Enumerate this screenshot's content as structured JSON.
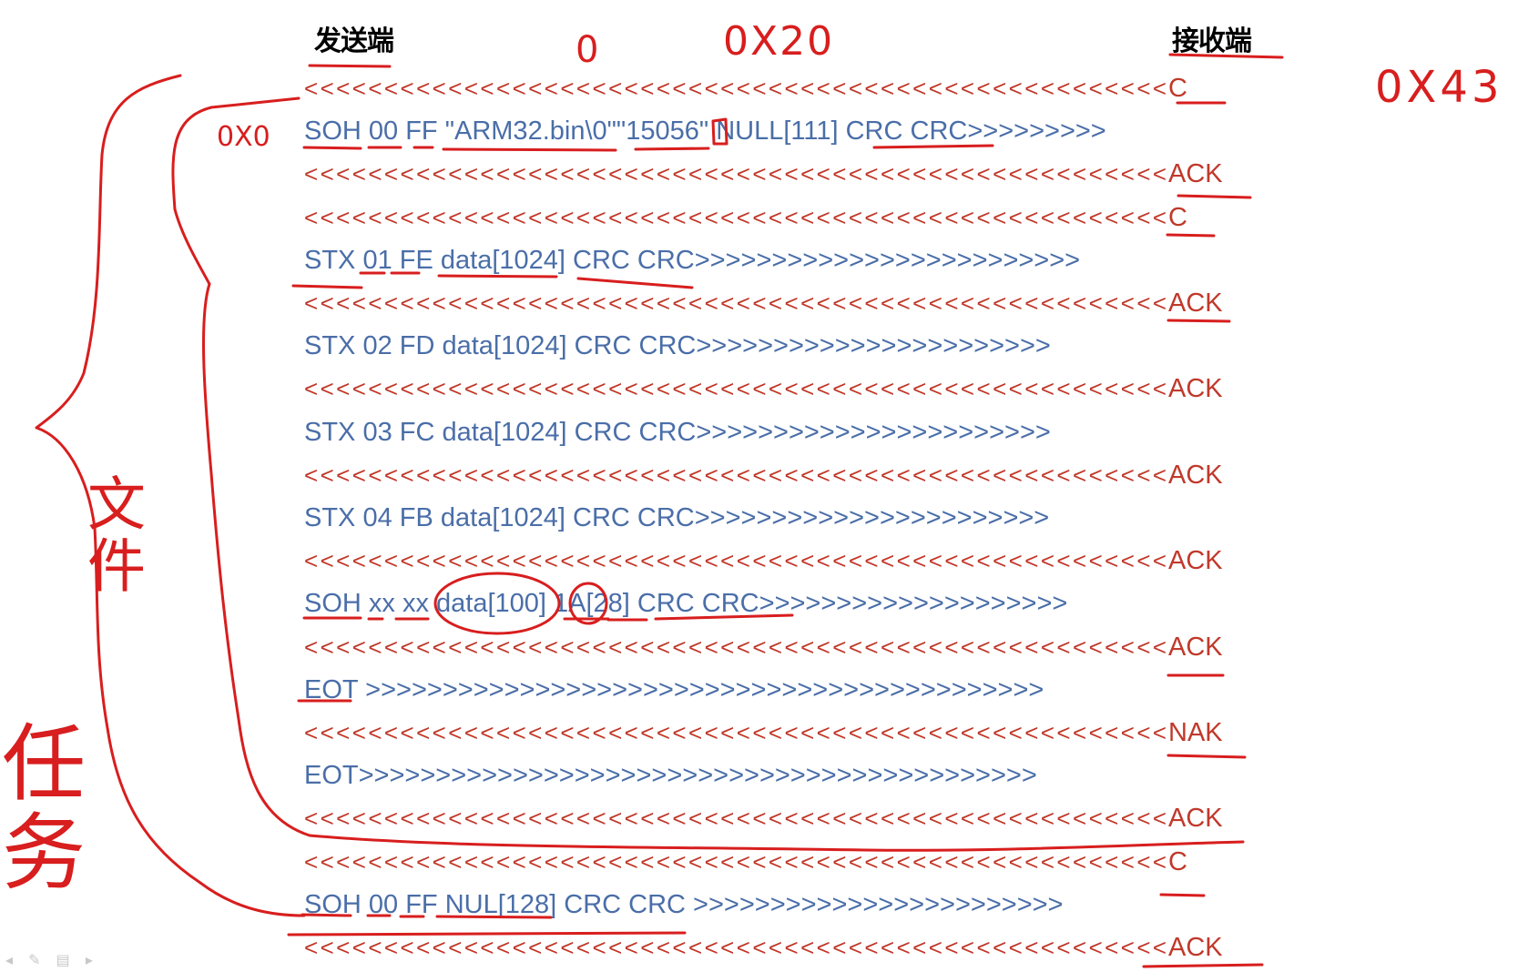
{
  "headers": {
    "sender": "发送端",
    "receiver": "接收端"
  },
  "annotations": {
    "top_zero": "0",
    "top_hex": "0X20",
    "right_hex": "0X43",
    "left_hex": "0X0",
    "side_file": "文件",
    "side_task": "任务"
  },
  "rows": [
    {
      "left": "<<<<<<<<<<<<<<<<<<<<<<<<<<<<<<<<<<<<<<<<<<<<<<<<<<<<<<",
      "right": "C",
      "dir": "back"
    },
    {
      "left": "SOH 00 FF \"ARM32.bin\\0\"\"15056\" NULL[111] CRC CRC>>>>>>>>>",
      "right": "",
      "dir": "fwd"
    },
    {
      "left": "<<<<<<<<<<<<<<<<<<<<<<<<<<<<<<<<<<<<<<<<<<<<<<<<<<<<<<",
      "right": "ACK",
      "dir": "back"
    },
    {
      "left": "<<<<<<<<<<<<<<<<<<<<<<<<<<<<<<<<<<<<<<<<<<<<<<<<<<<<<<",
      "right": "C",
      "dir": "back"
    },
    {
      "left": "STX 01 FE data[1024] CRC CRC>>>>>>>>>>>>>>>>>>>>>>>>>",
      "right": "",
      "dir": "fwd"
    },
    {
      "left": "<<<<<<<<<<<<<<<<<<<<<<<<<<<<<<<<<<<<<<<<<<<<<<<<<<<<<<",
      "right": "ACK",
      "dir": "back"
    },
    {
      "left": "STX 02 FD data[1024] CRC CRC>>>>>>>>>>>>>>>>>>>>>>>",
      "right": "",
      "dir": "fwd"
    },
    {
      "left": "<<<<<<<<<<<<<<<<<<<<<<<<<<<<<<<<<<<<<<<<<<<<<<<<<<<<<<",
      "right": "ACK",
      "dir": "back"
    },
    {
      "left": "STX 03 FC data[1024] CRC CRC>>>>>>>>>>>>>>>>>>>>>>>",
      "right": "",
      "dir": "fwd"
    },
    {
      "left": "<<<<<<<<<<<<<<<<<<<<<<<<<<<<<<<<<<<<<<<<<<<<<<<<<<<<<<",
      "right": "ACK",
      "dir": "back"
    },
    {
      "left": "STX 04 FB data[1024] CRC CRC>>>>>>>>>>>>>>>>>>>>>>>",
      "right": "",
      "dir": "fwd"
    },
    {
      "left": "<<<<<<<<<<<<<<<<<<<<<<<<<<<<<<<<<<<<<<<<<<<<<<<<<<<<<<",
      "right": "ACK",
      "dir": "back"
    },
    {
      "left": "SOH xx xx data[100] 1A[28] CRC CRC>>>>>>>>>>>>>>>>>>>>",
      "right": "",
      "dir": "fwd"
    },
    {
      "left": "<<<<<<<<<<<<<<<<<<<<<<<<<<<<<<<<<<<<<<<<<<<<<<<<<<<<<<",
      "right": "ACK",
      "dir": "back"
    },
    {
      "left": "EOT >>>>>>>>>>>>>>>>>>>>>>>>>>>>>>>>>>>>>>>>>>>>",
      "right": "",
      "dir": "fwd"
    },
    {
      "left": "<<<<<<<<<<<<<<<<<<<<<<<<<<<<<<<<<<<<<<<<<<<<<<<<<<<<<<",
      "right": "NAK",
      "dir": "back"
    },
    {
      "left": "EOT>>>>>>>>>>>>>>>>>>>>>>>>>>>>>>>>>>>>>>>>>>>>",
      "right": "",
      "dir": "fwd"
    },
    {
      "left": "<<<<<<<<<<<<<<<<<<<<<<<<<<<<<<<<<<<<<<<<<<<<<<<<<<<<<<",
      "right": "ACK",
      "dir": "back"
    },
    {
      "left": "<<<<<<<<<<<<<<<<<<<<<<<<<<<<<<<<<<<<<<<<<<<<<<<<<<<<<<",
      "right": "C",
      "dir": "back"
    },
    {
      "left": "SOH 00 FF NUL[128] CRC CRC >>>>>>>>>>>>>>>>>>>>>>>>",
      "right": "",
      "dir": "fwd"
    },
    {
      "left": "<<<<<<<<<<<<<<<<<<<<<<<<<<<<<<<<<<<<<<<<<<<<<<<<<<<<<<",
      "right": "ACK",
      "dir": "back"
    }
  ],
  "colors": {
    "forward_text": "#4a6ea8",
    "backward_text": "#c0392b",
    "ink": "#d81e1e"
  }
}
